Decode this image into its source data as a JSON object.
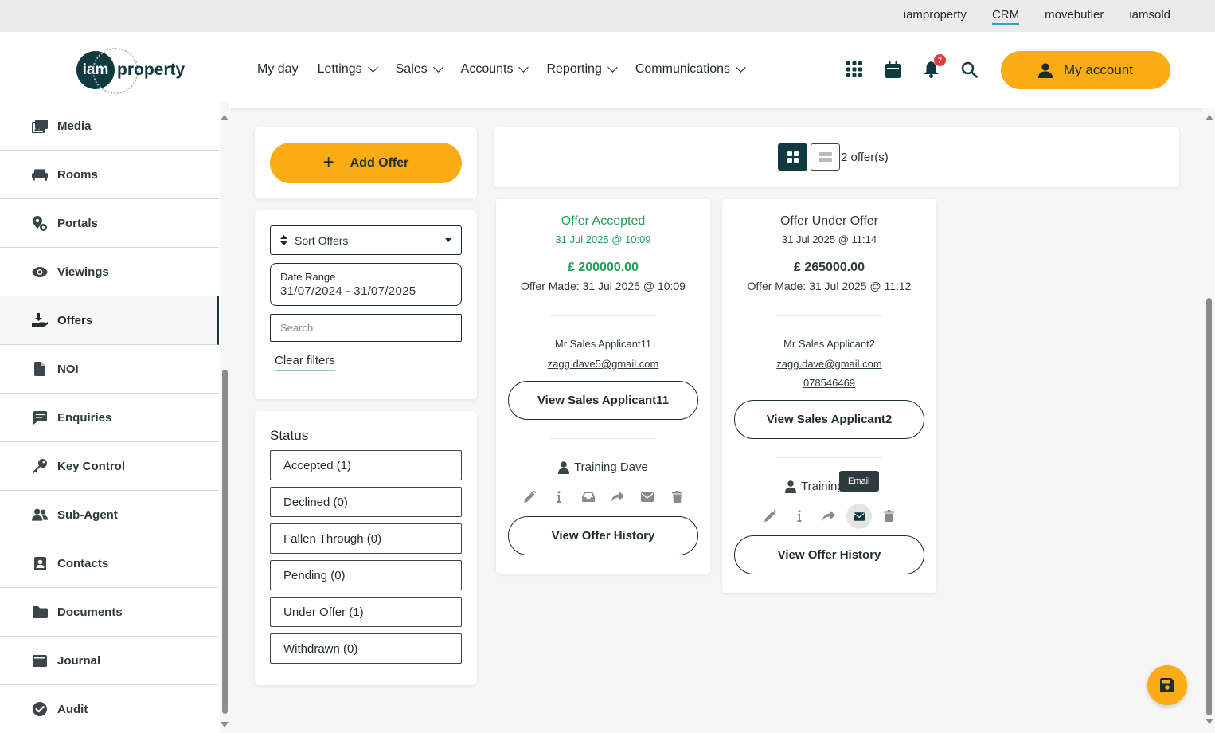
{
  "topbar": {
    "links": [
      {
        "label": "iamproperty",
        "active": false
      },
      {
        "label": "CRM",
        "active": true
      },
      {
        "label": "movebutler",
        "active": false
      },
      {
        "label": "iamsold",
        "active": false
      }
    ]
  },
  "header": {
    "logo": {
      "mark": "iam",
      "text": "property"
    },
    "nav": [
      {
        "label": "My day",
        "dropdown": false
      },
      {
        "label": "Lettings",
        "dropdown": true
      },
      {
        "label": "Sales",
        "dropdown": true
      },
      {
        "label": "Accounts",
        "dropdown": true
      },
      {
        "label": "Reporting",
        "dropdown": true
      },
      {
        "label": "Communications",
        "dropdown": true
      }
    ],
    "icons": [
      "apps-grid-icon",
      "calendar-icon",
      "bell-icon",
      "search-icon"
    ],
    "notification_count": "7",
    "account_label": "My account"
  },
  "sidebar": {
    "items": [
      {
        "label": "Media",
        "icon": "media-icon",
        "active": false
      },
      {
        "label": "Rooms",
        "icon": "sofa-icon",
        "active": false
      },
      {
        "label": "Portals",
        "icon": "portals-icon",
        "active": false
      },
      {
        "label": "Viewings",
        "icon": "eye-icon",
        "active": false
      },
      {
        "label": "Offers",
        "icon": "offer-hand-icon",
        "active": true
      },
      {
        "label": "NOI",
        "icon": "file-icon",
        "active": false
      },
      {
        "label": "Enquiries",
        "icon": "message-icon",
        "active": false
      },
      {
        "label": "Key Control",
        "icon": "key-icon",
        "active": false
      },
      {
        "label": "Sub-Agent",
        "icon": "users-icon",
        "active": false
      },
      {
        "label": "Contacts",
        "icon": "contact-card-icon",
        "active": false
      },
      {
        "label": "Documents",
        "icon": "folder-icon",
        "active": false
      },
      {
        "label": "Journal",
        "icon": "journal-icon",
        "active": false
      },
      {
        "label": "Audit",
        "icon": "check-circle-icon",
        "active": false
      }
    ]
  },
  "filters": {
    "add_offer_label": "Add Offer",
    "sort_label": "Sort Offers",
    "date_range_label": "Date Range",
    "date_range_value": "31/07/2024 - 31/07/2025",
    "search_placeholder": "Search",
    "clear_filters_label": "Clear filters"
  },
  "status": {
    "title": "Status",
    "options": [
      "Accepted (1)",
      "Declined (0)",
      "Fallen Through (0)",
      "Pending (0)",
      "Under Offer (1)",
      "Withdrawn (0)"
    ]
  },
  "offers_bar": {
    "count_label": "2 offer(s)"
  },
  "offers": [
    {
      "status": "Offer Accepted",
      "date": "31 Jul 2025 @ 10:09",
      "amount": "£ 200000.00",
      "made": "Offer Made: 31 Jul 2025 @ 10:09",
      "applicant": "Mr Sales Applicant11",
      "email": "zagg.dave5@gmail.com",
      "phone": "",
      "view_applicant_label": "View Sales Applicant11",
      "agent": "Training Dave",
      "history_label": "View Offer History",
      "status_color": "#1f9e55"
    },
    {
      "status": "Offer Under Offer",
      "date": "31 Jul 2025 @ 11:14",
      "amount": "£ 265000.00",
      "made": "Offer Made: 31 Jul 2025 @ 11:12",
      "applicant": "Mr Sales Applicant2",
      "email": "zagg.dave@gmail.com",
      "phone": "078546469",
      "view_applicant_label": "View Sales Applicant2",
      "agent": "Training",
      "history_label": "View Offer History",
      "status_color": "#2c3a3e"
    }
  ],
  "tooltip": {
    "label": "Email"
  },
  "colors": {
    "accent": "#fbab14",
    "brand_dark": "#0e3a40",
    "accepted_green": "#1f9e55",
    "notification_red": "#e23b3b"
  }
}
